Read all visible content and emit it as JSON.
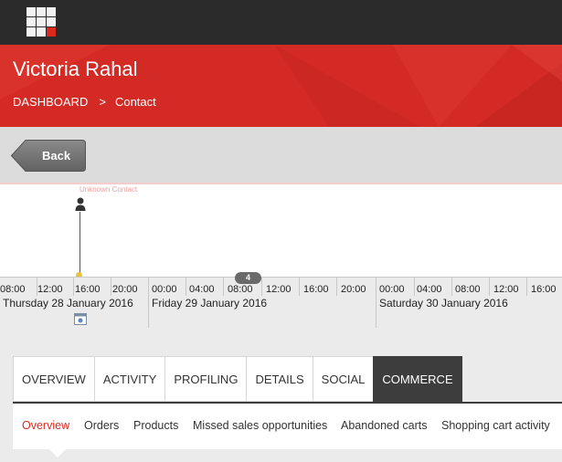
{
  "header": {
    "title": "Victoria Rahal",
    "breadcrumb": {
      "root": "DASHBOARD",
      "separator": ">",
      "current": "Contact"
    },
    "accent_color": "#d42a25"
  },
  "toolbar": {
    "back_label": "Back"
  },
  "timeline": {
    "event_label": "Unknown Contact",
    "interaction_count": "4",
    "days": [
      {
        "label": "Thursday 28 January 2016",
        "hours": [
          "08:00",
          "12:00",
          "16:00",
          "20:00"
        ]
      },
      {
        "label": "Friday 29 January 2016",
        "hours": [
          "00:00",
          "04:00",
          "08:00",
          "12:00",
          "16:00",
          "20:00"
        ]
      },
      {
        "label": "Saturday 30 January 2016",
        "hours": [
          "00:00",
          "04:00",
          "08:00",
          "12:00",
          "16:00"
        ]
      }
    ]
  },
  "tabs": [
    "OVERVIEW",
    "ACTIVITY",
    "PROFILING",
    "DETAILS",
    "SOCIAL",
    "COMMERCE"
  ],
  "active_tab": "COMMERCE",
  "subnav": {
    "items": [
      "Overview",
      "Orders",
      "Products",
      "Missed sales opportunities",
      "Abandoned carts",
      "Shopping cart activity"
    ],
    "active": "Overview",
    "active_color": "#dc291e"
  },
  "icons": {
    "app_launcher": "grid-icon",
    "person": "person-icon",
    "calendar": "calendar-icon"
  }
}
